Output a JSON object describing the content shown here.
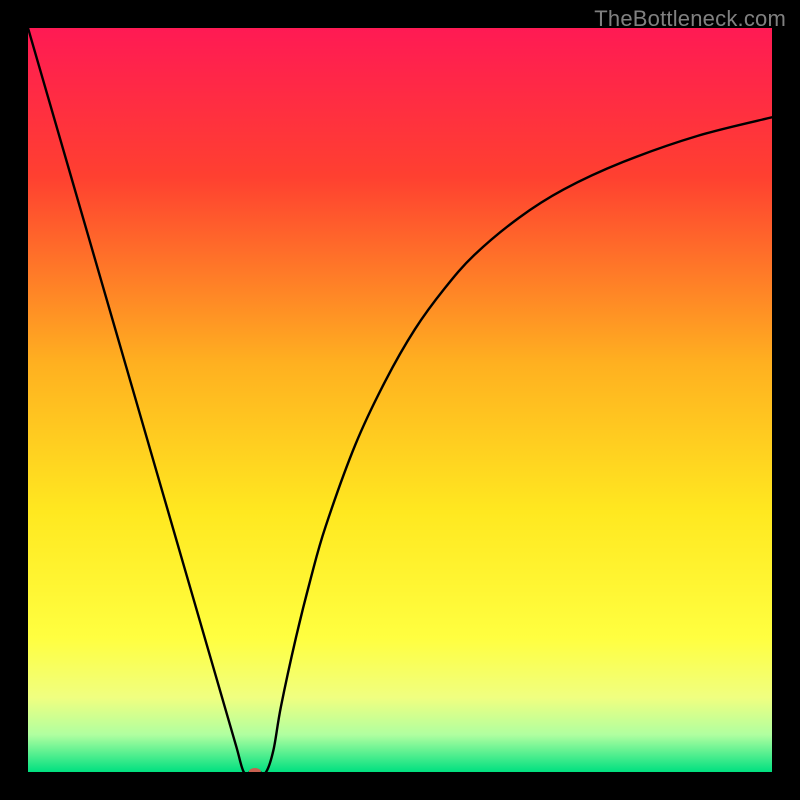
{
  "watermark": "TheBottleneck.com",
  "chart_data": {
    "type": "line",
    "title": "",
    "xlabel": "",
    "ylabel": "",
    "xlim": [
      0,
      100
    ],
    "ylim": [
      0,
      100
    ],
    "grid": false,
    "legend": false,
    "background_gradient": {
      "stops": [
        {
          "offset": 0.0,
          "color": "#ff1a54"
        },
        {
          "offset": 0.2,
          "color": "#ff4030"
        },
        {
          "offset": 0.45,
          "color": "#ffb020"
        },
        {
          "offset": 0.65,
          "color": "#ffe820"
        },
        {
          "offset": 0.82,
          "color": "#ffff40"
        },
        {
          "offset": 0.9,
          "color": "#f0ff80"
        },
        {
          "offset": 0.95,
          "color": "#b0ffa0"
        },
        {
          "offset": 1.0,
          "color": "#00e080"
        }
      ]
    },
    "series": [
      {
        "name": "bottleneck-curve",
        "color": "#000000",
        "x": [
          0,
          2,
          4,
          6,
          8,
          10,
          12,
          14,
          16,
          18,
          20,
          22,
          24,
          26,
          28,
          29,
          30,
          31,
          32,
          33,
          34,
          36,
          38,
          40,
          44,
          48,
          52,
          56,
          60,
          66,
          72,
          80,
          90,
          100
        ],
        "y": [
          100,
          93.1,
          86.2,
          79.3,
          72.4,
          65.5,
          58.6,
          51.7,
          44.8,
          37.9,
          31.0,
          24.1,
          17.2,
          10.3,
          3.4,
          0.0,
          0.0,
          0.0,
          0.0,
          3.0,
          8.8,
          18.0,
          26.0,
          33.0,
          44.0,
          52.5,
          59.5,
          65.0,
          69.5,
          74.5,
          78.3,
          82.0,
          85.5,
          88.0
        ]
      }
    ],
    "marker": {
      "name": "optimal-point",
      "x": 30.5,
      "y": 0,
      "color": "#c86050",
      "rx": 6,
      "ry": 4
    }
  }
}
